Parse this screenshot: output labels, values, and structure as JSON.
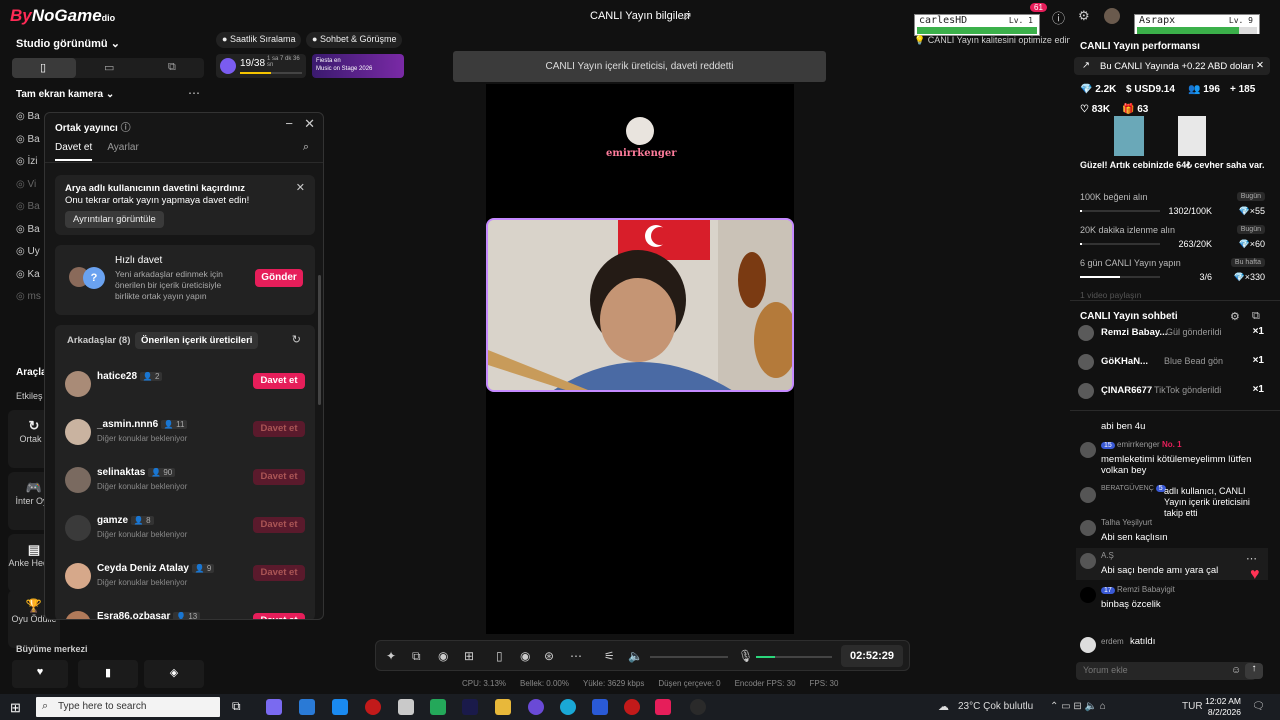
{
  "app": {
    "logo_prefix": "By",
    "logo_suffix": "NoGame",
    "logo_sub": "dio",
    "live_title": "CANLI Yayın bilgileri",
    "notification_count": "61"
  },
  "hp_boxes": [
    {
      "name": "carlesHD",
      "level": "Lv. 1",
      "hp_fraction": 1.0
    },
    {
      "name": "Asrapx",
      "level": "Lv. 9",
      "hp_fraction": 0.85
    }
  ],
  "left": {
    "studio_view": "Studio görünümü",
    "fullscreen_camera": "Tam ekran kamera",
    "tools_heading": "Araçla",
    "tools_subheading": "Etkileş",
    "tool_cards": [
      {
        "icon": "rotate-icon",
        "label": "Ortak y"
      },
      {
        "icon": "game-icon",
        "label": "İnter Oyu"
      },
      {
        "icon": "gift-icon",
        "label": "Anke Hediye"
      },
      {
        "icon": "trophy-icon",
        "label": "Oyu Ödülle"
      }
    ],
    "growth": "Büyüme merkezi",
    "menu_stubs": [
      "Ba",
      "Ba",
      "İzi",
      "Vi",
      "Ba",
      "Ba",
      "Uy",
      "Ka",
      "ms"
    ]
  },
  "badges": {
    "hourly": "Saatlik Sıralama",
    "chat_meet": "Sohbet & Görüşme",
    "progress": "19/38",
    "progress_fraction": 0.5,
    "timer_small": "1 sa 7 dk 36 sn",
    "promo_line1": "Fiesta en",
    "promo_line2": "Music on Stage 2026"
  },
  "panel": {
    "title": "Ortak yayıncı",
    "tab_invite": "Davet et",
    "tab_settings": "Ayarlar",
    "notice_title": "Arya adlı kullanıcının davetini kaçırdınız",
    "notice_sub": "Onu tekrar ortak yayın yapmaya davet edin!",
    "notice_btn": "Ayrıntıları görüntüle",
    "quick_title": "Hızlı davet",
    "quick_desc1": "Yeni arkadaşlar edinmek için",
    "quick_desc2": "önerilen bir içerik üreticisiyle",
    "quick_desc3": "birlikte ortak yayın yapın",
    "quick_btn": "Gönder",
    "friends_tab": "Arkadaşlar (8)",
    "suggested_tab": "Önerilen içerik üreticileri",
    "invite_label": "Davet et",
    "rows": [
      {
        "name": "hatice28",
        "count": "2",
        "sub": "",
        "enabled": true
      },
      {
        "name": "_asmin.nnn6",
        "count": "11",
        "sub": "Diğer konuklar bekleniyor",
        "enabled": false
      },
      {
        "name": "selinaktas",
        "count": "90",
        "sub": "Diğer konuklar bekleniyor",
        "enabled": false
      },
      {
        "name": "gamze",
        "count": "8",
        "sub": "Diğer konuklar bekleniyor",
        "enabled": false
      },
      {
        "name": "Ceyda Deniz Atalay",
        "count": "9",
        "sub": "Diğer konuklar bekleniyor",
        "enabled": false
      },
      {
        "name": "Esra86.ozbasar",
        "count": "13",
        "sub": "",
        "enabled": true
      }
    ]
  },
  "stage": {
    "toast": "CANLI Yayın içerik üreticisi, daveti reddetti",
    "streamer": "emirrkenger",
    "quality_tip": "CANLI Yayın kalitesini optimize edin"
  },
  "controls": {
    "timer": "02:52:29",
    "mic_level": 0.25,
    "stats": [
      "CPU: 3.13%",
      "Bellek: 0.00%",
      "Yükle: 3629 kbps",
      "Düşen çerçeve: 0",
      "Encoder FPS: 30",
      "FPS: 30"
    ]
  },
  "right": {
    "performance_title": "CANLI Yayın performansı",
    "earning_pill": "Bu CANLI Yayında +0.22 ABD doları",
    "stats": {
      "diamonds": "2.2K",
      "usd": "USD9.14",
      "viewers": "196",
      "followers": "185",
      "likes": "83K",
      "gifts": "63"
    },
    "treasure": "Güzel! Artık cebinizde 64₺ cevher saha var.",
    "goals": [
      {
        "title": "100K beğeni alın",
        "tag": "Bugün",
        "progress": "1302/100K",
        "fraction": 0.013,
        "reward": "×55"
      },
      {
        "title": "20K dakika izlenme alın",
        "tag": "Bugün",
        "progress": "263/20K",
        "fraction": 0.013,
        "reward": "×60"
      },
      {
        "title": "6 gün CANLI Yayın yapın",
        "tag": "Bu hafta",
        "progress": "3/6",
        "fraction": 0.5,
        "reward": "×330"
      }
    ],
    "goal_cutoff": "1 video paylaşın",
    "chat_title": "CANLI Yayın sohbeti",
    "gifts": [
      {
        "user": "Remzi Babay...",
        "msg": "Gül gönderildi",
        "count": "×1"
      },
      {
        "user": "GöKHaN...",
        "msg": "Blue Bead gön",
        "count": "×1"
      },
      {
        "user": "ÇINAR6677",
        "msg": "TikTok gönderildi",
        "count": "×1"
      }
    ],
    "chat": [
      {
        "user": "",
        "msg": "abi ben 4u"
      },
      {
        "user": "emirrkenger",
        "badge": "15",
        "tag": "No. 1",
        "msg": "memleketimi kötülemeyelimm lütfen volkan bey"
      },
      {
        "user": "BERATGÜVENÇ",
        "badge": "5",
        "msg": "adlı kullanıcı, CANLI Yayın içerik üreticisini takip etti"
      },
      {
        "user": "Talha Yeşilyurt",
        "msg": "Abi sen kaçlısın"
      },
      {
        "user": "A.Ş",
        "msg": "Abi saçı bende amı yara çal"
      },
      {
        "user": "Remzi Babayigit",
        "badge": "17",
        "msg": "binbaş özcelik"
      },
      {
        "user": "erdem",
        "msg": "katıldı"
      }
    ],
    "comment_placeholder": "Yorum ekle"
  },
  "taskbar": {
    "search": "Type here to search",
    "weather": "23°C Çok bulutlu",
    "lang": "TUR",
    "time": "12:02 AM",
    "date": "8/2/2026"
  }
}
